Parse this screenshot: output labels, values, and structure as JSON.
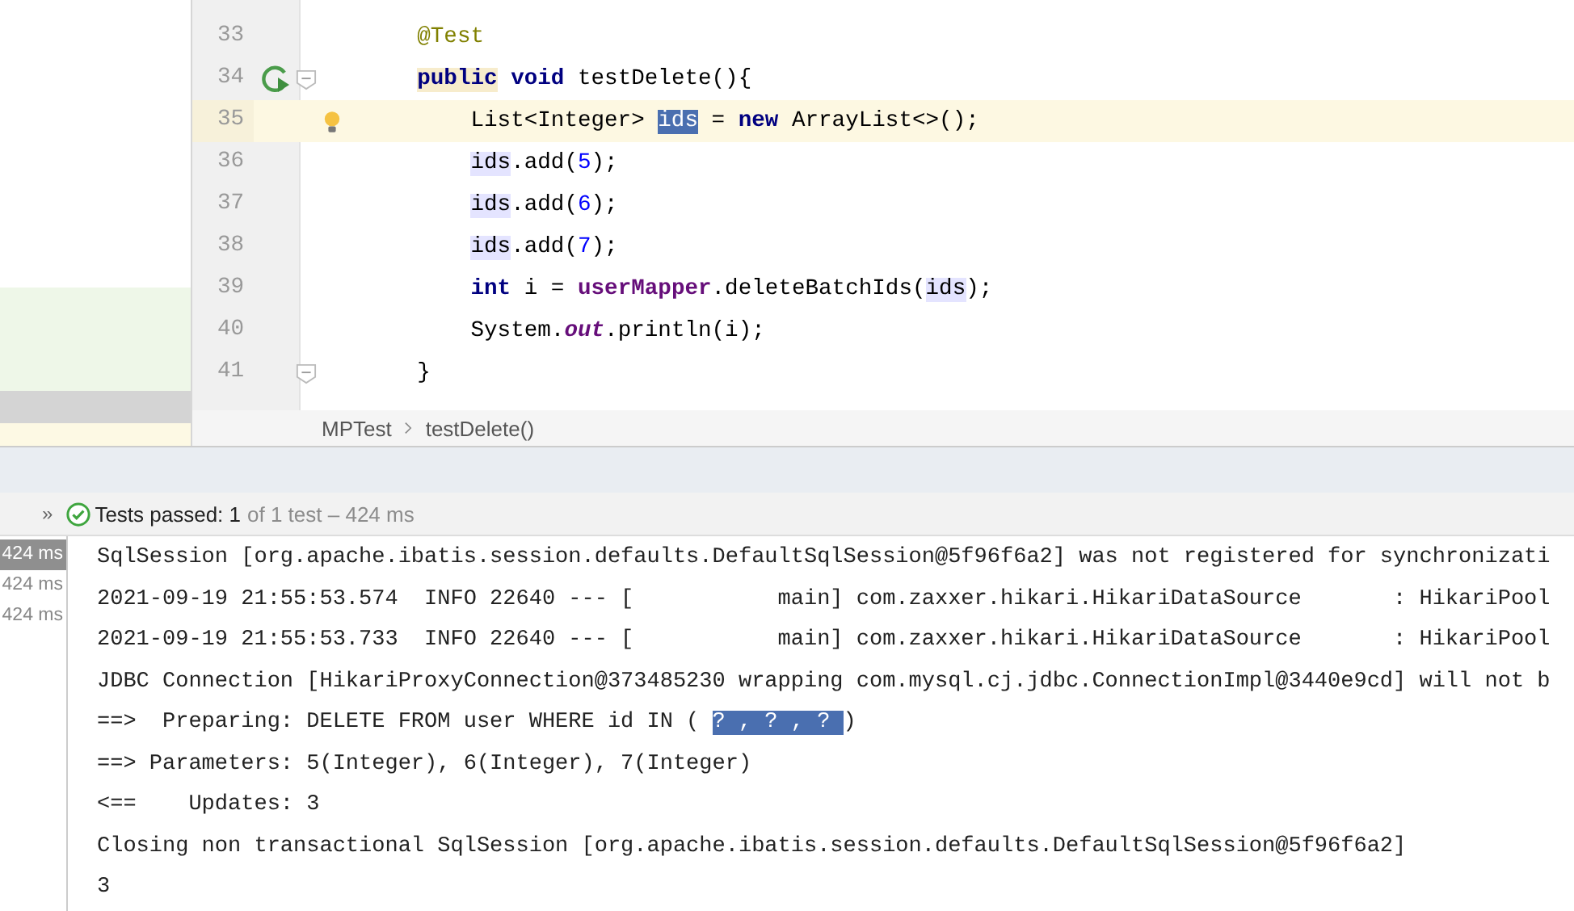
{
  "editor": {
    "lines": [
      {
        "number": "33",
        "current": false,
        "fold": false,
        "tokens": [
          {
            "kind": "annotation",
            "text": "@Test"
          }
        ]
      },
      {
        "number": "34",
        "current": false,
        "fold": true,
        "tokens": [
          {
            "kind": "keyword-mark",
            "text": "public"
          },
          {
            "kind": "keyword",
            "text": " void"
          },
          {
            "kind": "plain",
            "text": " testDelete(){"
          }
        ],
        "children": [
          {
            "number": "35",
            "current": true,
            "fold": false,
            "tokens": [
              {
                "kind": "plain",
                "text": "List<Integer> "
              },
              {
                "kind": "selected",
                "text": "ids"
              },
              {
                "kind": "plain",
                "text": " = "
              },
              {
                "kind": "keyword",
                "text": "new"
              },
              {
                "kind": "plain",
                "text": " ArrayList<>();"
              }
            ]
          },
          {
            "number": "36",
            "current": false,
            "fold": false,
            "tokens": [
              {
                "kind": "usage",
                "text": "ids"
              },
              {
                "kind": "plain",
                "text": ".add("
              },
              {
                "kind": "number",
                "text": "5"
              },
              {
                "kind": "plain",
                "text": ");"
              }
            ]
          },
          {
            "number": "37",
            "current": false,
            "fold": false,
            "tokens": [
              {
                "kind": "usage",
                "text": "ids"
              },
              {
                "kind": "plain",
                "text": ".add("
              },
              {
                "kind": "number",
                "text": "6"
              },
              {
                "kind": "plain",
                "text": ");"
              }
            ]
          },
          {
            "number": "38",
            "current": false,
            "fold": false,
            "tokens": [
              {
                "kind": "usage",
                "text": "ids"
              },
              {
                "kind": "plain",
                "text": ".add("
              },
              {
                "kind": "number",
                "text": "7"
              },
              {
                "kind": "plain",
                "text": ");"
              }
            ]
          },
          {
            "number": "39",
            "current": false,
            "fold": false,
            "tokens": [
              {
                "kind": "keyword",
                "text": "int"
              },
              {
                "kind": "plain",
                "text": " i = "
              },
              {
                "kind": "field",
                "text": "userMapper"
              },
              {
                "kind": "plain",
                "text": ".deleteBatchIds("
              },
              {
                "kind": "usage",
                "text": "ids"
              },
              {
                "kind": "plain",
                "text": ");"
              }
            ]
          },
          {
            "number": "40",
            "current": false,
            "fold": false,
            "tokens": [
              {
                "kind": "plain",
                "text": "System."
              },
              {
                "kind": "static",
                "text": "out"
              },
              {
                "kind": "plain",
                "text": ".println(i);"
              }
            ]
          }
        ]
      },
      {
        "number": "41",
        "current": false,
        "fold": true,
        "tokens": [
          {
            "kind": "plain",
            "text": "}"
          }
        ]
      }
    ]
  },
  "breadcrumbs": [
    "MPTest",
    "testDelete()"
  ],
  "test_bar": {
    "expand": "»",
    "status": "Tests passed: 1",
    "detail": "of 1 test – 424 ms"
  },
  "timings": [
    {
      "text": "424 ms",
      "selected": true
    },
    {
      "text": "424 ms",
      "selected": false
    },
    {
      "text": "424 ms",
      "selected": false
    }
  ],
  "console": [
    [
      {
        "text": "SqlSession [org.apache.ibatis.session.defaults.DefaultSqlSession@5f96f6a2] was not registered for synchronizati",
        "selected": false
      }
    ],
    [
      {
        "text": "2021-09-19 21:55:53.574  INFO 22640 --- [           main] com.zaxxer.hikari.HikariDataSource       : HikariPool",
        "selected": false
      }
    ],
    [
      {
        "text": "2021-09-19 21:55:53.733  INFO 22640 --- [           main] com.zaxxer.hikari.HikariDataSource       : HikariPool",
        "selected": false
      }
    ],
    [
      {
        "text": "JDBC Connection [HikariProxyConnection@373485230 wrapping com.mysql.cj.jdbc.ConnectionImpl@3440e9cd] will not b",
        "selected": false
      }
    ],
    [
      {
        "text": "==>  Preparing: DELETE FROM user WHERE id IN ( ",
        "selected": false
      },
      {
        "text": "? , ? , ? ",
        "selected": true
      },
      {
        "text": ")",
        "selected": false
      }
    ],
    [
      {
        "text": "==> Parameters: 5(Integer), 6(Integer), 7(Integer)",
        "selected": false
      }
    ],
    [
      {
        "text": "<==    Updates: 3",
        "selected": false
      }
    ],
    [
      {
        "text": "Closing non transactional SqlSession [org.apache.ibatis.session.defaults.DefaultSqlSession@5f96f6a2]",
        "selected": false
      }
    ],
    [
      {
        "text": "3",
        "selected": false
      }
    ]
  ]
}
